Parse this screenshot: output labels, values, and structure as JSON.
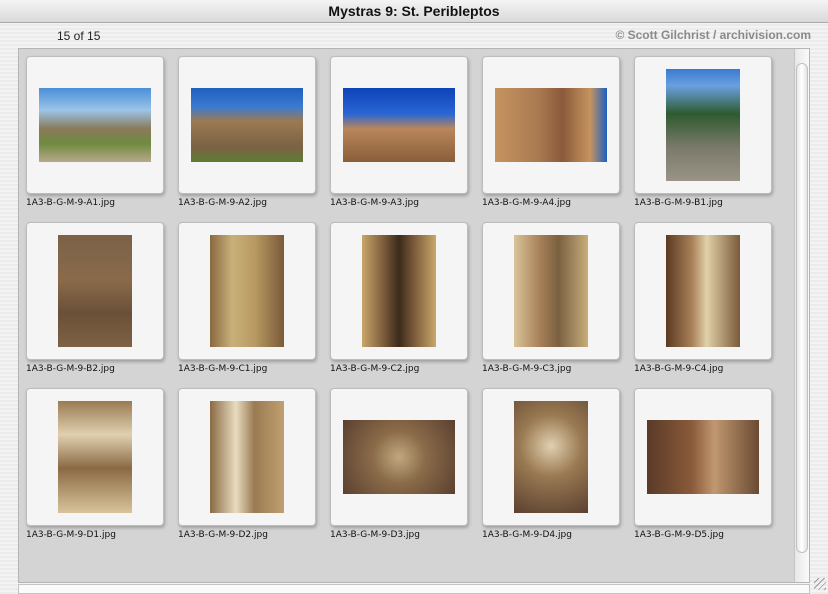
{
  "window": {
    "title": "Mystras 9: St. Peribleptos"
  },
  "header": {
    "count": "15 of 15",
    "copyright": "© Scott Gilchrist / archivision.com"
  },
  "items": [
    {
      "label": "1A3-B-G-M-9-A1.jpg"
    },
    {
      "label": "1A3-B-G-M-9-A2.jpg"
    },
    {
      "label": "1A3-B-G-M-9-A3.jpg"
    },
    {
      "label": "1A3-B-G-M-9-A4.jpg"
    },
    {
      "label": "1A3-B-G-M-9-B1.jpg"
    },
    {
      "label": "1A3-B-G-M-9-B2.jpg"
    },
    {
      "label": "1A3-B-G-M-9-C1.jpg"
    },
    {
      "label": "1A3-B-G-M-9-C2.jpg"
    },
    {
      "label": "1A3-B-G-M-9-C3.jpg"
    },
    {
      "label": "1A3-B-G-M-9-C4.jpg"
    },
    {
      "label": "1A3-B-G-M-9-D1.jpg"
    },
    {
      "label": "1A3-B-G-M-9-D2.jpg"
    },
    {
      "label": "1A3-B-G-M-9-D3.jpg"
    },
    {
      "label": "1A3-B-G-M-9-D4.jpg"
    },
    {
      "label": "1A3-B-G-M-9-D5.jpg"
    }
  ]
}
